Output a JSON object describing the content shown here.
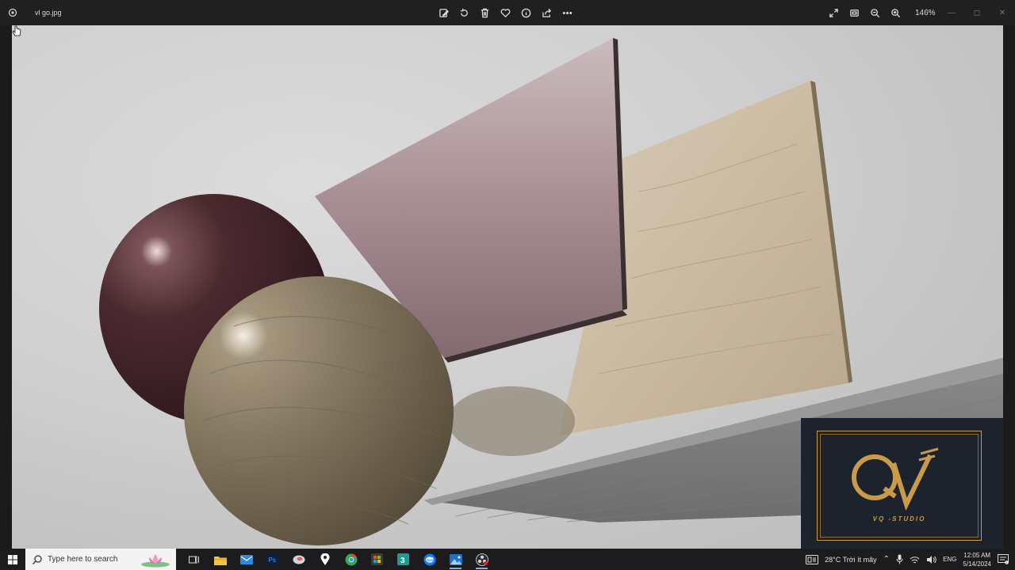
{
  "window": {
    "file_name": "vl go.jpg",
    "zoom": "146%"
  },
  "toolbar": {
    "items": [
      "edit-image-icon",
      "rotate-icon",
      "delete-icon",
      "favorite-icon",
      "info-icon",
      "share-icon",
      "more-icon"
    ]
  },
  "viewer_tools": [
    "fullscreen-icon",
    "fit-to-window-icon",
    "zoom-out-icon",
    "zoom-in-icon"
  ],
  "watermark": {
    "studio": "VQ -STUDIO",
    "accent": "#c99a4a",
    "background": "#1d232c"
  },
  "taskbar": {
    "search_placeholder": "Type here to search",
    "apps": [
      "task-view-icon",
      "file-explorer-icon",
      "mail-icon",
      "photoshop-icon",
      "app-icon",
      "maps-icon",
      "chrome-icon",
      "store-icon",
      "3ds-max-icon",
      "zalo-icon",
      "photos-icon",
      "obs-icon"
    ],
    "active_app": "photos-icon"
  },
  "tray": {
    "weather": "28°C  Trời ít mây",
    "language": "ENG",
    "time": "12:05 AM",
    "date": "5/14/2024"
  }
}
